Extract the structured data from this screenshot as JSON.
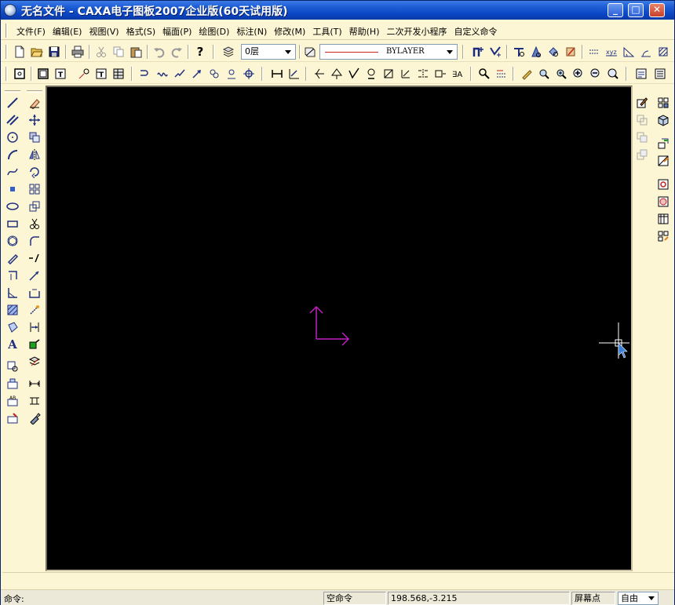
{
  "window": {
    "title": "无名文件 - CAXA电子图板2007企业版(60天试用版)",
    "controls": {
      "minimize": "_",
      "maximize": "□",
      "close": "✕"
    }
  },
  "menubar": {
    "items": [
      "文件(F)",
      "编辑(E)",
      "视图(V)",
      "格式(S)",
      "幅面(P)",
      "绘图(D)",
      "标注(N)",
      "修改(M)",
      "工具(T)",
      "帮助(H)",
      "二次开发小程序",
      "自定义命令"
    ]
  },
  "toolbar": {
    "layer_value": "0层",
    "linetype_value": "BYLAYER",
    "linetype_color": "#cc2222"
  },
  "canvas": {
    "background": "#000000",
    "ucs_color": "#c020c0",
    "cursor_color": "#ffffff"
  },
  "statusbar": {
    "command_label": "命令:",
    "command_status": "空命令",
    "coordinates": "198.568,-3.215",
    "snap_mode": "屏幕点",
    "mode_select": "自由"
  },
  "colors": {
    "panel": "#fcf6d4",
    "titlebar": "#0a46c4"
  }
}
